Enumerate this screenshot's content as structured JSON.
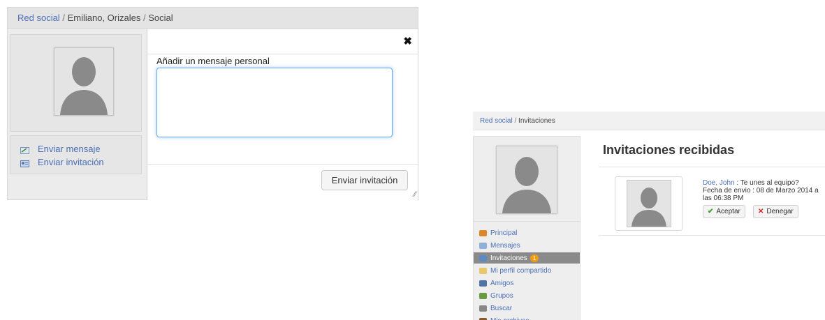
{
  "left": {
    "breadcrumb": {
      "root": "Red social",
      "sep1": "/",
      "user": "Emiliano, Orizales",
      "sep2": "/",
      "current": "Social"
    },
    "actions": {
      "send_message": "Enviar mensaje",
      "send_invitation": "Enviar invitación"
    },
    "modal": {
      "close_symbol": "✖",
      "label": "Añadir un mensaje personal",
      "message_value": "",
      "send_button": "Enviar invitación"
    }
  },
  "right": {
    "breadcrumb": {
      "root": "Red social",
      "sep": "/",
      "current": "Invitaciones"
    },
    "menu": {
      "items": [
        {
          "label": "Principal",
          "icon": "home-icon",
          "color": "#d9882b"
        },
        {
          "label": "Mensajes",
          "icon": "envelope-icon",
          "color": "#8fb0d8"
        },
        {
          "label": "Invitaciones",
          "icon": "invitations-icon",
          "color": "#5c8bc4",
          "badge": "1",
          "active": true
        },
        {
          "label": "Mi perfil compartido",
          "icon": "folder-icon",
          "color": "#e8c86a"
        },
        {
          "label": "Amigos",
          "icon": "person-icon",
          "color": "#4f72a8"
        },
        {
          "label": "Grupos",
          "icon": "group-icon",
          "color": "#6a9a3e"
        },
        {
          "label": "Buscar",
          "icon": "search-icon",
          "color": "#888888"
        },
        {
          "label": "Mis archivos",
          "icon": "briefcase-icon",
          "color": "#8b5a2b"
        }
      ]
    },
    "heading": "Invitaciones recibidas",
    "invitation": {
      "from": "Doe, John",
      "message": ": Te unes al equipo?",
      "date_line": "Fecha de envio : 08 de Marzo 2014 a las 06:38 PM",
      "accept": "Aceptar",
      "deny": "Denegar"
    }
  },
  "colors": {
    "link": "#4a6fb5",
    "focus": "#66a9e8",
    "badge": "#f39c12",
    "accept_icon": "#3a9a2a",
    "deny_icon": "#d22"
  }
}
